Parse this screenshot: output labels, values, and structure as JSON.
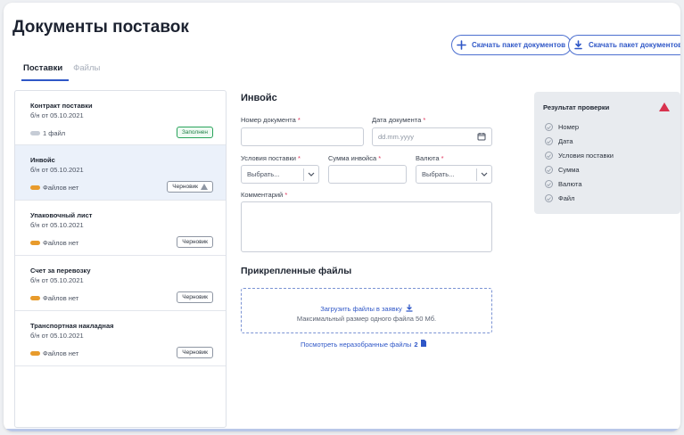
{
  "page": {
    "title": "Документы поставок"
  },
  "header_buttons": [
    {
      "label": "Скачать пакет документов",
      "icon": "plus-icon"
    },
    {
      "label": "Скачать пакет документов",
      "icon": "download-icon"
    }
  ],
  "tabs": [
    {
      "label": "Поставки",
      "active": true
    },
    {
      "label": "Файлы",
      "active": false
    }
  ],
  "documents": [
    {
      "title": "Контракт поставки",
      "subtitle": "б/н от 05.10.2021",
      "files": "1 файл",
      "status": "Заполнен",
      "status_type": "ok",
      "warning": false,
      "selected": false
    },
    {
      "title": "Инвойс",
      "subtitle": "б/н от 05.10.2021",
      "files": "Файлов нет",
      "status": "Черновик",
      "status_type": "draft",
      "warning": true,
      "selected": true
    },
    {
      "title": "Упаковочный лист",
      "subtitle": "б/н от 05.10.2021",
      "files": "Файлов нет",
      "status": "Черновик",
      "status_type": "draft",
      "warning": false,
      "selected": false
    },
    {
      "title": "Счет за перевозку",
      "subtitle": "б/н от 05.10.2021",
      "files": "Файлов нет",
      "status": "Черновик",
      "status_type": "draft",
      "warning": false,
      "selected": false
    },
    {
      "title": "Транспортная накладная",
      "subtitle": "б/н от 05.10.2021",
      "files": "Файлов нет",
      "status": "Черновик",
      "status_type": "draft",
      "warning": false,
      "selected": false
    }
  ],
  "form": {
    "title": "Инвойс",
    "doc_number_label": "Номер документа",
    "doc_number_value": "",
    "doc_date_label": "Дата документа",
    "doc_date_placeholder": "dd.mm.yyyy",
    "terms_label": "Условия поставки",
    "terms_value": "Выбрать...",
    "amount_label": "Сумма инвойса",
    "amount_value": "",
    "currency_label": "Валюта",
    "currency_value": "Выбрать...",
    "comment_label": "Комментарий",
    "comment_value": "",
    "required_mark": "*"
  },
  "attachments": {
    "title": "Прикрепленные файлы",
    "upload_link": "Загрузить файлы в заявку",
    "hint": "Максимальный размер одного файла 50 Мб.",
    "unsorted_link": "Посмотреть неразобранные файлы",
    "unsorted_count": "2"
  },
  "check": {
    "title": "Результат проверки",
    "items": [
      "Номер",
      "Дата",
      "Условия поставки",
      "Сумма",
      "Валюта",
      "Файл"
    ]
  },
  "colors": {
    "accent": "#2f57c7",
    "error": "#d8324e",
    "ok": "#29a35b",
    "clip": "#e89b2c",
    "selected_bg": "#ebf1fa"
  }
}
